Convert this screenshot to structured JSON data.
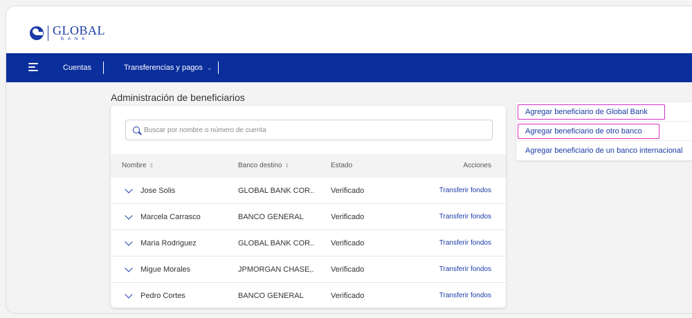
{
  "brand": {
    "name": "GLOBAL",
    "sub": "BANK"
  },
  "nav": {
    "menu_icon": "hamburger-icon",
    "cuentas": "Cuentas",
    "transferencias": "Transferencias y pagos",
    "transferencias_chevron": "⌄"
  },
  "page": {
    "title": "Administración de beneficiarios"
  },
  "search": {
    "placeholder": "Buscar por nombre o número de cuenta",
    "icon": "search-icon"
  },
  "table": {
    "headers": {
      "nombre": "Nombre",
      "banco": "Banco destino",
      "estado": "Estado",
      "acciones": "Acciones",
      "sort_glyph": "⇕"
    },
    "rows": [
      {
        "nombre": "Jose Solis",
        "banco": "GLOBAL BANK COR..",
        "estado": "Verificado",
        "accion": "Transferir fondos"
      },
      {
        "nombre": "Marcela Carrasco",
        "banco": "BANCO GENERAL",
        "estado": "Verificado",
        "accion": "Transferir fondos"
      },
      {
        "nombre": "Maria Rodriguez",
        "banco": "GLOBAL BANK COR..",
        "estado": "Verificado",
        "accion": "Transferir fondos"
      },
      {
        "nombre": "Migue Morales",
        "banco": "JPMORGAN CHASE,.",
        "estado": "Verificado",
        "accion": "Transferir fondos"
      },
      {
        "nombre": "Pedro Cortes",
        "banco": "BANCO GENERAL",
        "estado": "Verificado",
        "accion": "Transferir fondos"
      }
    ]
  },
  "side_menu": {
    "items": [
      "Agregar beneficiario de Global Bank",
      "Agregar beneficiario de otro banco",
      "Agregar beneficiario de un banco internacional"
    ]
  },
  "colors": {
    "primary": "#0a2e9c",
    "link": "#1a3aa6",
    "highlight": "#d62fc4"
  }
}
